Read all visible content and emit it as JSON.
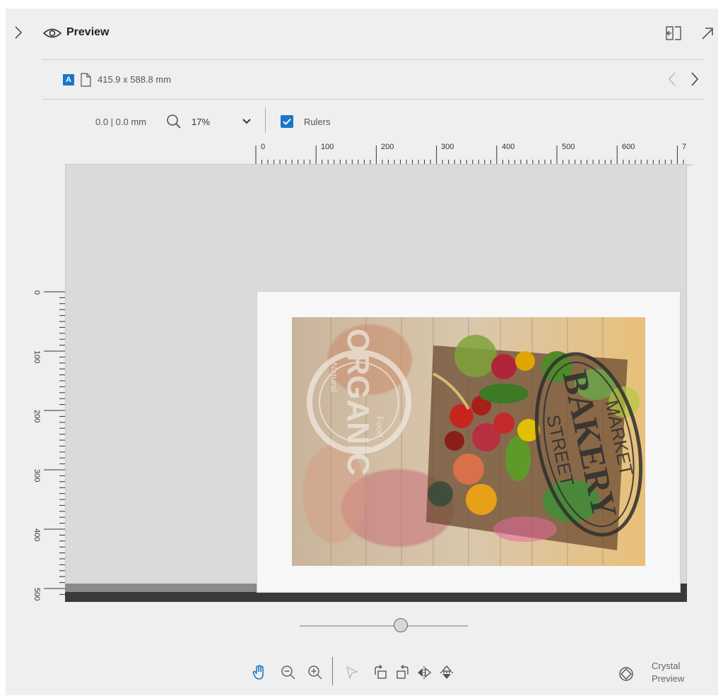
{
  "header": {
    "title": "Preview"
  },
  "page_info": {
    "badge": "A",
    "size": "415.9 x 588.8 mm"
  },
  "toolbar": {
    "coords": "0.0 | 0.0 mm",
    "zoom": "17%",
    "rulers_label": "Rulers",
    "rulers_checked": true
  },
  "ruler": {
    "top_labels": [
      "0",
      "100",
      "200",
      "300",
      "400",
      "500",
      "600",
      "7"
    ],
    "left_labels": [
      "0",
      "100",
      "200",
      "300",
      "400",
      "500"
    ]
  },
  "artwork": {
    "stamp_left_main": "ORGANIC",
    "stamp_left_sub1": "Food",
    "stamp_left_sub2": "Natural",
    "stamp_right_line1": "MARKET",
    "stamp_right_line2": "BAKERY",
    "stamp_right_line3": "STREET"
  },
  "zoom_slider": {
    "value_fraction": 0.6
  },
  "bottom_toolbar": {
    "crystal_line1": "Crystal",
    "crystal_line2": "Preview"
  },
  "colors": {
    "accent": "#1a76c9",
    "panel_bg": "#efefef",
    "canvas_bg": "#dadad8",
    "paper": "#f7f7f7"
  },
  "icons": [
    "chevron-right-icon",
    "eye-icon",
    "collapse-panel-icon",
    "pop-out-icon",
    "page-icon",
    "prev-icon",
    "next-icon",
    "search-icon",
    "dropdown-icon",
    "check-icon",
    "hand-tool-icon",
    "zoom-out-icon",
    "zoom-in-icon",
    "select-arrow-icon",
    "rotate-left-icon",
    "rotate-right-icon",
    "flip-horizontal-icon",
    "flip-vertical-icon",
    "crystal-preview-icon"
  ]
}
